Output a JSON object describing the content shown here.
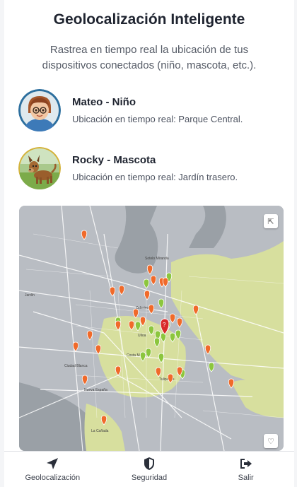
{
  "header": {
    "title": "Geolocalización Inteligente",
    "subtitle": "Rastrea en tiempo real la ubicación de tus dispositivos conectados (niño, mascota, etc.)."
  },
  "devices": [
    {
      "name": "Mateo - Niño",
      "location": "Ubicación en tiempo real: Parque Central.",
      "avatar_icon": "child-avatar"
    },
    {
      "name": "Rocky - Mascota",
      "location": "Ubicación en tiempo real: Jardín trasero.",
      "avatar_icon": "dog-avatar"
    }
  ],
  "map": {
    "labels": [
      "Sotelo Miranda",
      "Zeferino",
      "Ulloa",
      "Costa Mayor",
      "Ciudad Blanca",
      "Nueva España",
      "Jardín",
      "Tulipanes",
      "La Cañada"
    ],
    "colors": {
      "land": "#b9bdc3",
      "park": "#d6dfa0",
      "road": "#ffffff",
      "water": "#8e9499",
      "pin_orange": "#f06a2a",
      "pin_green": "#8cc63e",
      "pin_red": "#d92b2b"
    }
  },
  "nav": {
    "items": [
      {
        "label": "Geolocalización",
        "icon": "navigation-arrow-icon"
      },
      {
        "label": "Seguridad",
        "icon": "shield-icon"
      },
      {
        "label": "Salir",
        "icon": "logout-icon"
      }
    ]
  }
}
